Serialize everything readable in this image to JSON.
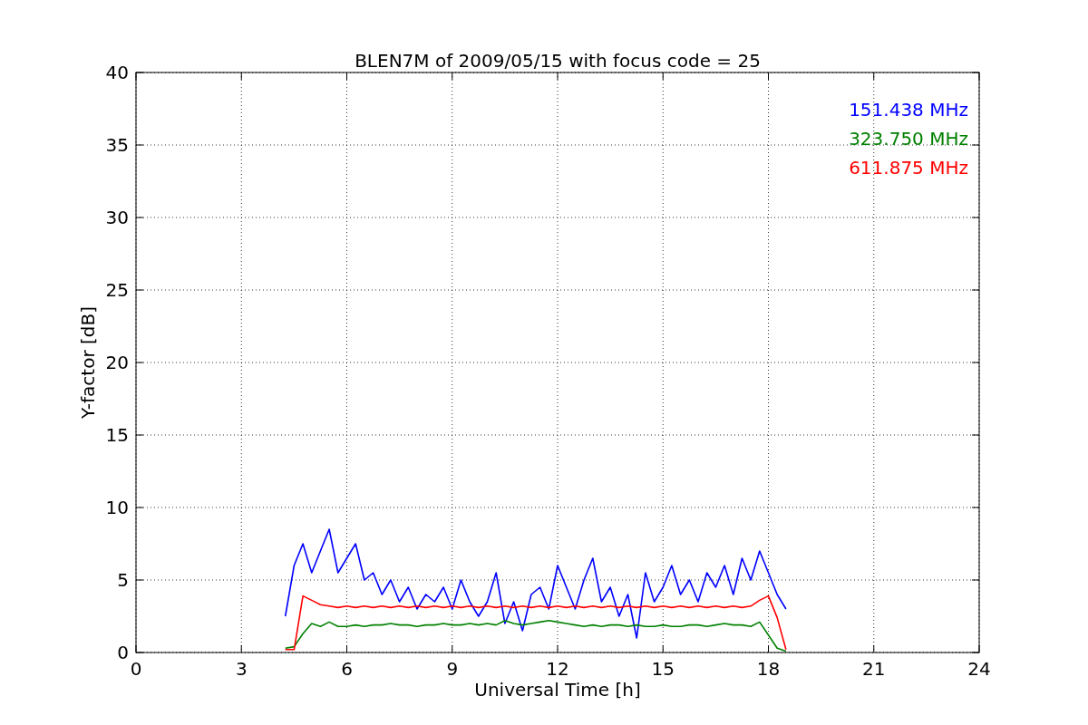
{
  "chart_data": {
    "type": "line",
    "title": "BLEN7M of 2009/05/15 with focus code = 25",
    "xlabel": "Universal Time [h]",
    "ylabel": "Y-factor [dB]",
    "x": [
      4.25,
      4.5,
      4.75,
      5.0,
      5.25,
      5.5,
      5.75,
      6.0,
      6.25,
      6.5,
      6.75,
      7.0,
      7.25,
      7.5,
      7.75,
      8.0,
      8.25,
      8.5,
      8.75,
      9.0,
      9.25,
      9.5,
      9.75,
      10.0,
      10.25,
      10.5,
      10.75,
      11.0,
      11.25,
      11.5,
      11.75,
      12.0,
      12.25,
      12.5,
      12.75,
      13.0,
      13.25,
      13.5,
      13.75,
      14.0,
      14.25,
      14.5,
      14.75,
      15.0,
      15.25,
      15.5,
      15.75,
      16.0,
      16.25,
      16.5,
      16.75,
      17.0,
      17.25,
      17.5,
      17.75,
      18.0,
      18.25,
      18.5
    ],
    "series": [
      {
        "name": "151.438 MHz",
        "color": "#0000ff",
        "values": [
          2.5,
          6.0,
          7.5,
          5.5,
          7.0,
          8.5,
          5.5,
          6.5,
          7.5,
          5.0,
          5.5,
          4.0,
          5.0,
          3.5,
          4.5,
          3.0,
          4.0,
          3.5,
          4.5,
          3.0,
          5.0,
          3.5,
          2.5,
          3.5,
          5.5,
          2.0,
          3.5,
          1.5,
          4.0,
          4.5,
          3.0,
          6.0,
          4.5,
          3.0,
          5.0,
          6.5,
          3.5,
          4.5,
          2.5,
          4.0,
          1.0,
          5.5,
          3.5,
          4.5,
          6.0,
          4.0,
          5.0,
          3.5,
          5.5,
          4.5,
          6.0,
          4.0,
          6.5,
          5.0,
          7.0,
          5.5,
          4.0,
          3.0
        ]
      },
      {
        "name": "323.750 MHz",
        "color": "#008000",
        "values": [
          0.3,
          0.4,
          1.3,
          2.0,
          1.8,
          2.1,
          1.8,
          1.8,
          1.9,
          1.8,
          1.9,
          1.9,
          2.0,
          1.9,
          1.9,
          1.8,
          1.9,
          1.9,
          2.0,
          1.9,
          1.9,
          2.0,
          1.9,
          2.0,
          1.9,
          2.2,
          2.0,
          1.9,
          2.0,
          2.1,
          2.2,
          2.1,
          2.0,
          1.9,
          1.8,
          1.9,
          1.8,
          1.9,
          1.9,
          1.8,
          1.9,
          1.8,
          1.8,
          1.9,
          1.8,
          1.8,
          1.9,
          1.9,
          1.8,
          1.9,
          2.0,
          1.9,
          1.9,
          1.8,
          2.1,
          1.2,
          0.3,
          0.1
        ]
      },
      {
        "name": "611.875 MHz",
        "color": "#ff0000",
        "values": [
          0.2,
          0.2,
          3.9,
          3.6,
          3.3,
          3.2,
          3.1,
          3.2,
          3.1,
          3.2,
          3.1,
          3.2,
          3.1,
          3.2,
          3.1,
          3.2,
          3.1,
          3.2,
          3.1,
          3.2,
          3.1,
          3.2,
          3.1,
          3.2,
          3.1,
          3.2,
          3.1,
          3.2,
          3.1,
          3.2,
          3.1,
          3.2,
          3.1,
          3.2,
          3.1,
          3.2,
          3.1,
          3.2,
          3.1,
          3.2,
          3.1,
          3.2,
          3.1,
          3.2,
          3.1,
          3.2,
          3.1,
          3.2,
          3.1,
          3.2,
          3.1,
          3.2,
          3.1,
          3.2,
          3.6,
          3.9,
          2.4,
          0.2
        ]
      }
    ],
    "grid": true,
    "xlim": [
      0,
      24
    ],
    "ylim": [
      0,
      40
    ],
    "xticks": [
      0,
      3,
      6,
      9,
      12,
      15,
      18,
      21,
      24
    ],
    "yticks": [
      0,
      5,
      10,
      15,
      20,
      25,
      30,
      35,
      40
    ]
  }
}
